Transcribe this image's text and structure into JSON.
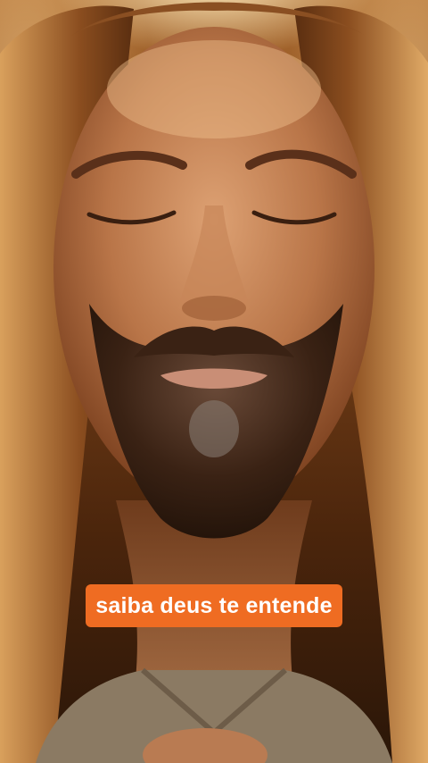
{
  "caption": {
    "text": "saiba deus te entende",
    "background_color": "#ef6c22",
    "text_color": "#ffffff"
  },
  "scene": {
    "palette": {
      "glow": "#ffe6b4",
      "hair": "#7a4319",
      "skin": "#c98a5c",
      "beard": "#3a2214",
      "robe": "#8b7a63"
    }
  }
}
